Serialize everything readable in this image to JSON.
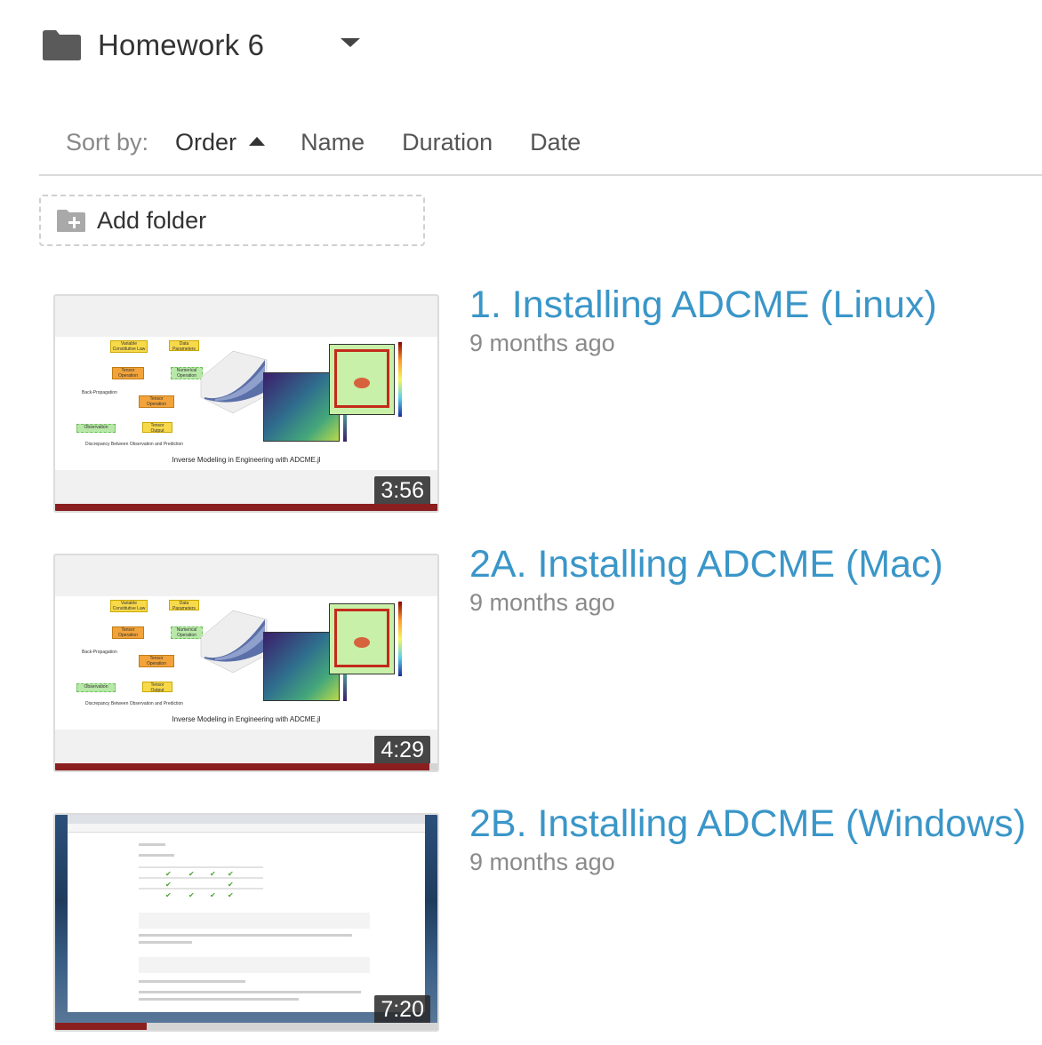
{
  "header": {
    "folder_name": "Homework 6"
  },
  "sort": {
    "label": "Sort by:",
    "options": [
      {
        "label": "Order",
        "active": true,
        "direction": "ascending"
      },
      {
        "label": "Name"
      },
      {
        "label": "Duration"
      },
      {
        "label": "Date"
      }
    ]
  },
  "add_folder": {
    "label": "Add folder"
  },
  "videos": [
    {
      "title": "1. Installing ADCME (Linux)",
      "date": "9 months ago",
      "duration": "3:56",
      "progress": 1.0,
      "thumb_caption": "Inverse Modeling in Engineering with ADCME.jl"
    },
    {
      "title": "2A. Installing ADCME (Mac)",
      "date": "9 months ago",
      "duration": "4:29",
      "progress": 0.98,
      "thumb_caption": "Inverse Modeling in Engineering with ADCME.jl"
    },
    {
      "title": "2B. Installing ADCME (Windows)",
      "date": "9 months ago",
      "duration": "7:20",
      "progress": 0.24
    }
  ],
  "colors": {
    "link": "#3a96c8",
    "progress": "#8b1f1f",
    "muted": "#8a8a8a"
  }
}
